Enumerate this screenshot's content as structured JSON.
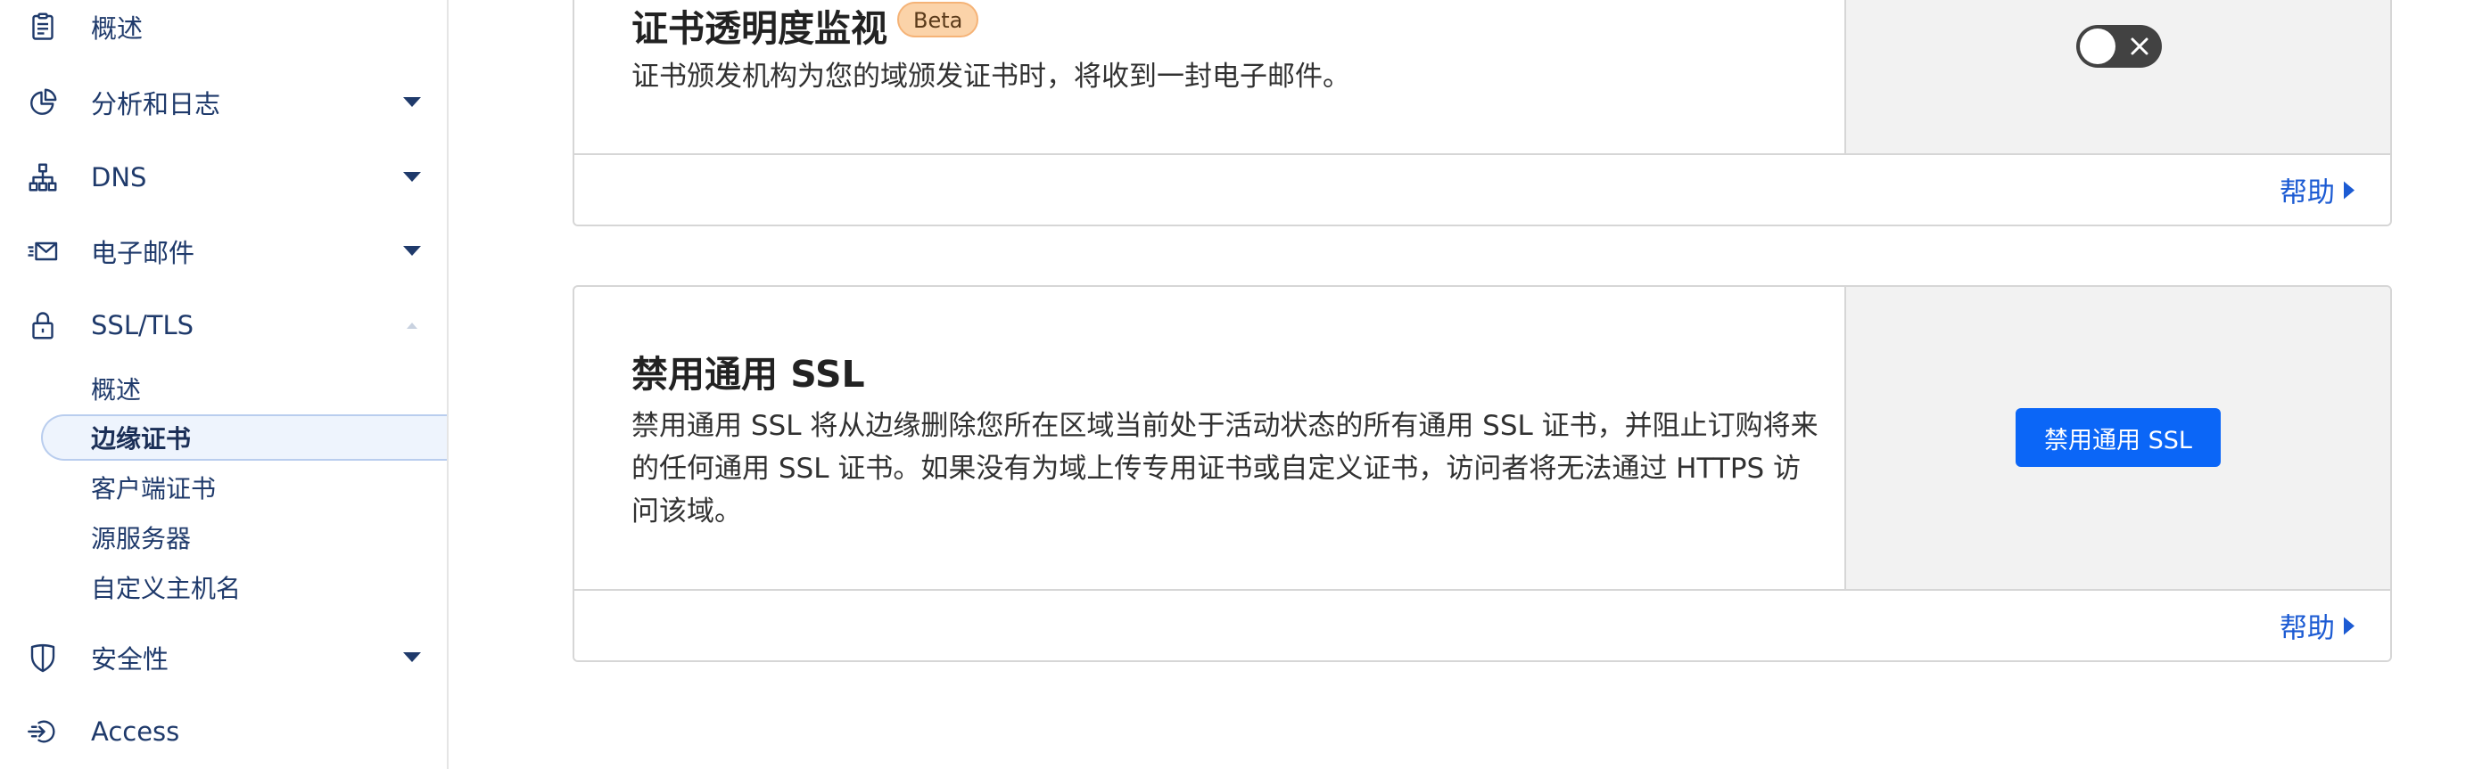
{
  "sidebar": {
    "items": [
      {
        "label": "概述",
        "icon": "clipboard-icon"
      },
      {
        "label": "分析和日志",
        "icon": "pie-chart-icon"
      },
      {
        "label": "DNS",
        "icon": "network-icon"
      },
      {
        "label": "电子邮件",
        "icon": "email-icon"
      },
      {
        "label": "SSL/TLS",
        "icon": "lock-icon"
      },
      {
        "label": "安全性",
        "icon": "shield-icon"
      },
      {
        "label": "Access",
        "icon": "access-icon"
      }
    ],
    "ssl_subitems": [
      {
        "label": "概述"
      },
      {
        "label": "边缘证书",
        "active": true
      },
      {
        "label": "客户端证书"
      },
      {
        "label": "源服务器"
      },
      {
        "label": "自定义主机名"
      }
    ]
  },
  "cards": {
    "ct_monitoring": {
      "title": "证书透明度监视",
      "badge": "Beta",
      "description": "证书颁发机构为您的域颁发证书时，将收到一封电子邮件。",
      "toggle_state": "off",
      "help_label": "帮助"
    },
    "disable_universal_ssl": {
      "title": "禁用通用 SSL",
      "description": "禁用通用 SSL 将从边缘删除您所在区域当前处于活动状态的所有通用 SSL 证书，并阻止订购将来的任何通用 SSL 证书。如果没有为域上传专用证书或自定义证书，访问者将无法通过 HTTPS 访问该域。",
      "button_label": "禁用通用 SSL",
      "help_label": "帮助"
    }
  },
  "colors": {
    "accent": "#0b66f7",
    "link": "#1c5bd3",
    "nav_text": "#1f3a6b",
    "badge_bg": "#fbd3a9",
    "toggle_off": "#424242",
    "panel_bg": "#f2f2f2"
  }
}
